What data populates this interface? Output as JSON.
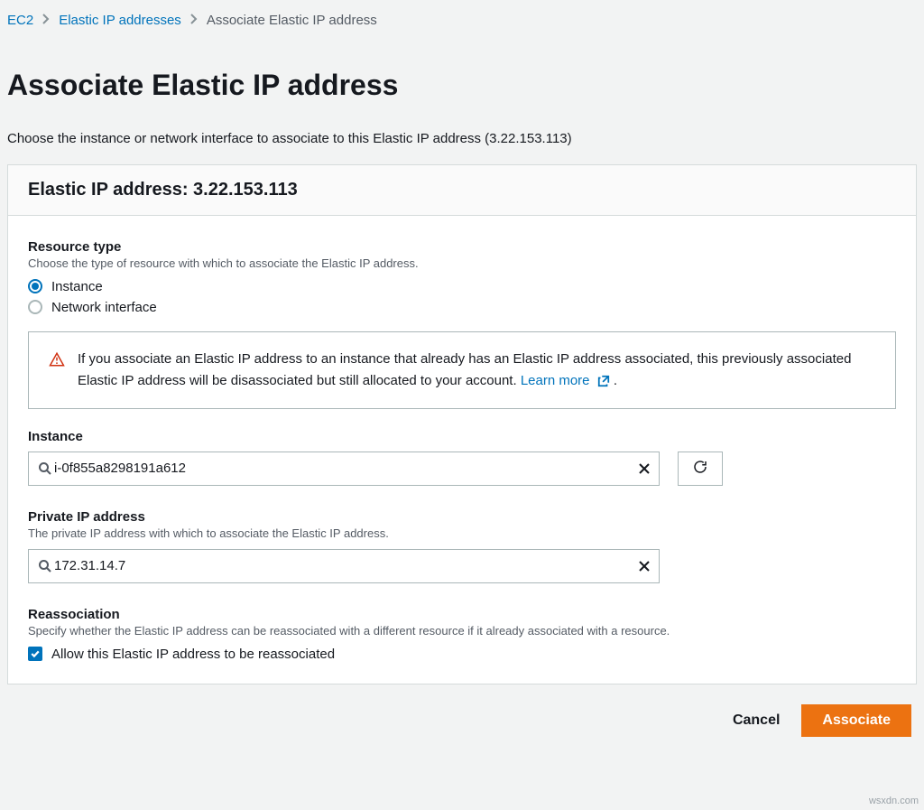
{
  "breadcrumb": {
    "level1": "EC2",
    "level2": "Elastic IP addresses",
    "current": "Associate Elastic IP address"
  },
  "page": {
    "title": "Associate Elastic IP address",
    "subtitle": "Choose the instance or network interface to associate to this Elastic IP address (3.22.153.113)"
  },
  "panel": {
    "header": "Elastic IP address: 3.22.153.113"
  },
  "resourceType": {
    "label": "Resource type",
    "hint": "Choose the type of resource with which to associate the Elastic IP address.",
    "options": {
      "instance": "Instance",
      "networkInterface": "Network interface"
    }
  },
  "alert": {
    "text": "If you associate an Elastic IP address to an instance that already has an Elastic IP address associated, this previously associated Elastic IP address will be disassociated but still allocated to your account. ",
    "learnMore": "Learn more"
  },
  "instance": {
    "label": "Instance",
    "value": "i-0f855a8298191a612"
  },
  "privateIp": {
    "label": "Private IP address",
    "hint": "The private IP address with which to associate the Elastic IP address.",
    "value": "172.31.14.7"
  },
  "reassociation": {
    "label": "Reassociation",
    "hint": "Specify whether the Elastic IP address can be reassociated with a different resource if it already associated with a resource.",
    "checkboxLabel": "Allow this Elastic IP address to be reassociated"
  },
  "footer": {
    "cancel": "Cancel",
    "submit": "Associate"
  },
  "watermark": "wsxdn.com"
}
